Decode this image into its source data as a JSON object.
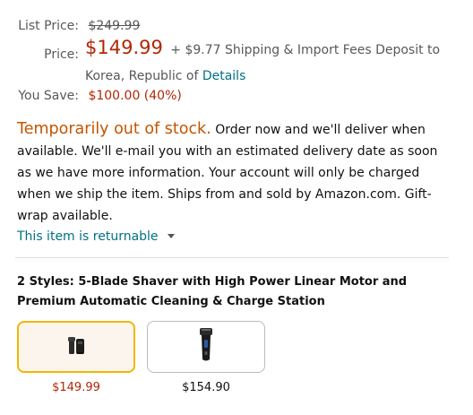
{
  "list_price": {
    "label": "List Price:",
    "value": "$249.99"
  },
  "price": {
    "label": "Price:",
    "value": "$149.99",
    "shipping": "+ $9.77 Shipping & Import Fees Deposit to",
    "shipping_line2": "Korea, Republic of",
    "details_link": "Details"
  },
  "savings": {
    "label": "You Save:",
    "value": "$100.00 (40%)"
  },
  "availability": {
    "status": "Temporarily out of stock.",
    "line1": "Order now and we'll deliver when",
    "line2": "available. We'll e-mail you with an estimated delivery date as soon",
    "line3": "as we have more information. Your account will only be charged",
    "line4": "when we ship the item. Ships from and sold by Amazon.com. Gift-",
    "line5": "wrap available."
  },
  "returnable": {
    "label": "This item is returnable"
  },
  "styles": {
    "line1": "2 Styles: 5-Blade Shaver with High Power Linear Motor and",
    "line2": "Premium Automatic Cleaning & Charge Station",
    "options": [
      {
        "price": "$149.99",
        "icon": "shaver-with-station-icon",
        "selected": true
      },
      {
        "price": "$154.90",
        "icon": "shaver-icon",
        "selected": false
      }
    ]
  },
  "colors": {
    "price_red": "#b12704",
    "link": "#007185",
    "out_of_stock": "#c45500",
    "selected_border": "#f0b800"
  }
}
